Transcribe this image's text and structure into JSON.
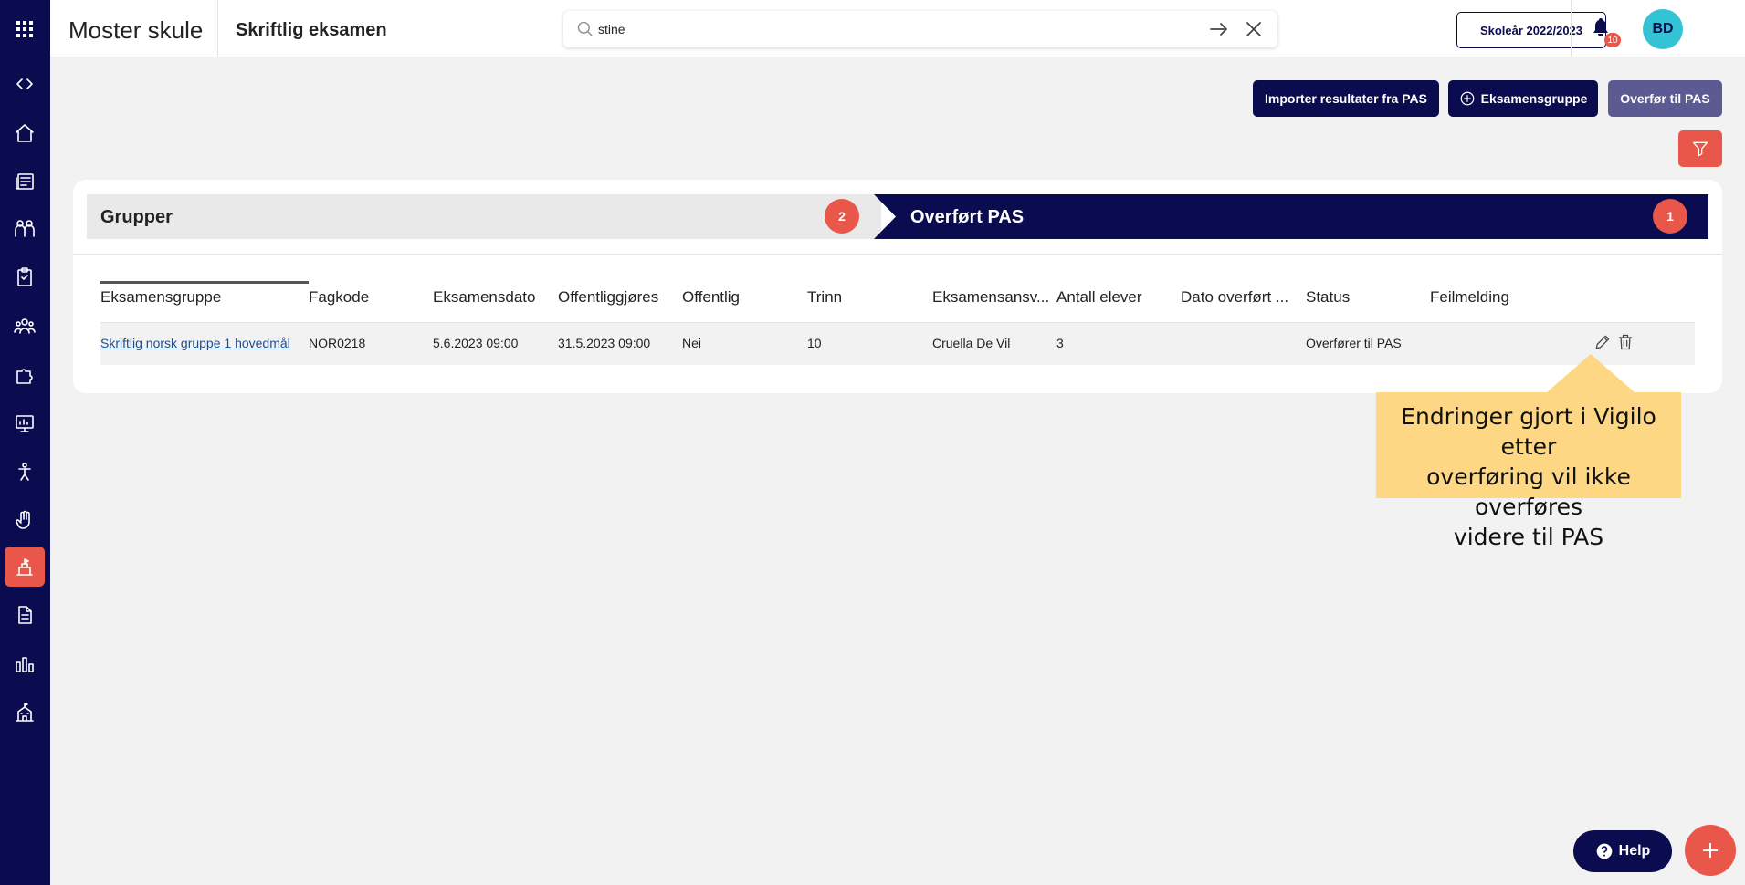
{
  "header": {
    "app_title": "Moster skule",
    "page_title": "Skriftlig eksamen",
    "search_value": "stine",
    "school_year_label": "Skoleår 2022/2023",
    "notification_count": "10",
    "avatar_initials": "BD"
  },
  "sidebar": {
    "icons": [
      "apps-grid-icon",
      "code-toggle-icon",
      "home-icon",
      "news-icon",
      "people-group-icon",
      "clipboard-icon",
      "community-icon",
      "puzzle-icon",
      "monitor-chart-icon",
      "accessibility-icon",
      "hand-icon",
      "exam-icon",
      "document-icon",
      "bar-chart-icon",
      "school-icon"
    ],
    "active": "exam-icon"
  },
  "actions": {
    "import_label": "Importer resultater fra PAS",
    "add_group_label": "Eksamensgruppe",
    "transfer_label": "Overfør til PAS"
  },
  "stages": [
    {
      "label": "Grupper",
      "count": "2"
    },
    {
      "label": "Overført PAS",
      "count": "1"
    }
  ],
  "table": {
    "headers": [
      "Eksamensgruppe",
      "Fagkode",
      "Eksamensdato",
      "Offentliggjøres",
      "Offentlig",
      "Trinn",
      "Eksamensansv...",
      "Antall elever",
      "Dato overført ...",
      "Status",
      "Feilmelding"
    ],
    "rows": [
      {
        "group": "Skriftlig norsk gruppe 1 hovedmål",
        "code": "NOR0218",
        "exam_date": "5.6.2023 09:00",
        "publish_date": "31.5.2023 09:00",
        "public": "Nei",
        "grade": "10",
        "responsible": "Cruella De Vil",
        "students": "3",
        "transferred": "",
        "status": "Overfører til PAS",
        "error": ""
      }
    ]
  },
  "callout": {
    "line1": "Endringer gjort i Vigilo etter",
    "line2": "overføring vil ikke overføres",
    "line3": "videre til PAS"
  },
  "help_label": "Help",
  "colors": {
    "navy": "#0b0b4f",
    "accent_red": "#e8574a",
    "transfer_button": "#5c5a92",
    "callout_yellow": "#fdd783",
    "avatar_teal": "#34c3d4"
  }
}
